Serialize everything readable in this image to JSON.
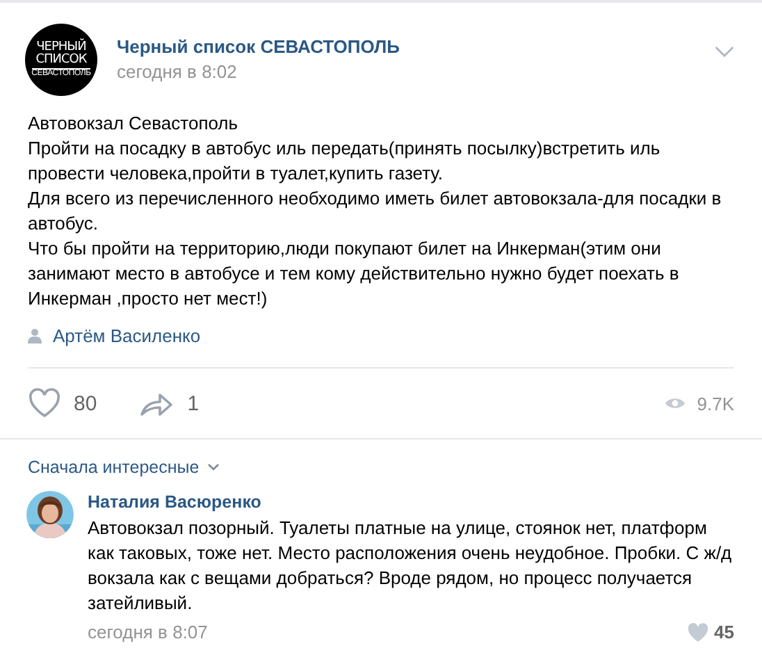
{
  "post": {
    "group_logo": [
      "ЧЕРНЫЙ",
      "СПИСОК",
      "СЕВАСТОПОЛЬ"
    ],
    "group_name": "Черный список СЕВАСТОПОЛЬ",
    "time": "сегодня в 8:02",
    "paragraphs": [
      "Автовокзал Севастополь",
      "Пройти на посадку в автобус иль передать(принять посылку)встретить иль провести человека,пройти в туалет,купить газету.",
      "Для всего из перечисленного необходимо иметь билет автовокзала-для посадки в автобус.",
      "Что бы пройти на территорию,люди покупают билет на Инкерман(этим они занимают место в автобусе и тем кому действительно нужно будет поехать в Инкерман ,просто нет мест!)"
    ],
    "signer": "Артём Василенко",
    "likes": "80",
    "shares": "1",
    "views": "9.7K"
  },
  "comments": {
    "sort": "Сначала интересные",
    "items": [
      {
        "author": "Наталия Васюренко",
        "text": "Автовокзал позорный. Туалеты платные на улице, стоянок нет, платформ как таковых, тоже нет. Место расположения очень неудобное. Пробки. С ж/д вокзала как с вещами добраться? Вроде рядом, но процесс получается затейливый.",
        "time": "сегодня в 8:07",
        "likes": "45"
      }
    ]
  }
}
